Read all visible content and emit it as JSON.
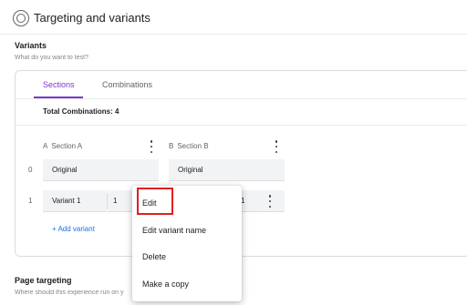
{
  "header": {
    "title": "Targeting and variants",
    "icon": "target-icon"
  },
  "variants": {
    "title": "Variants",
    "subtitle": "What do you want to test?",
    "tabs": [
      {
        "label": "Sections",
        "active": true
      },
      {
        "label": "Combinations",
        "active": false
      }
    ],
    "total_combinations": "Total Combinations: 4",
    "sections": [
      {
        "letter": "A",
        "name": "Section A"
      },
      {
        "letter": "B",
        "name": "Section B"
      }
    ],
    "rows": [
      {
        "index": "0",
        "a": "Original",
        "b": "Original"
      },
      {
        "index": "1",
        "a": "Variant 1",
        "a_extra": "1",
        "b_extra": "1"
      }
    ],
    "add_variant": "+ Add variant"
  },
  "context_menu": {
    "items": [
      "Edit",
      "Edit variant name",
      "Delete",
      "Make a copy"
    ],
    "highlight_color": "#e02020"
  },
  "page_targeting": {
    "title": "Page targeting",
    "subtitle": "Where should this experience run on y"
  },
  "colors": {
    "accent": "#7b38c6",
    "link": "#1a73e8"
  }
}
